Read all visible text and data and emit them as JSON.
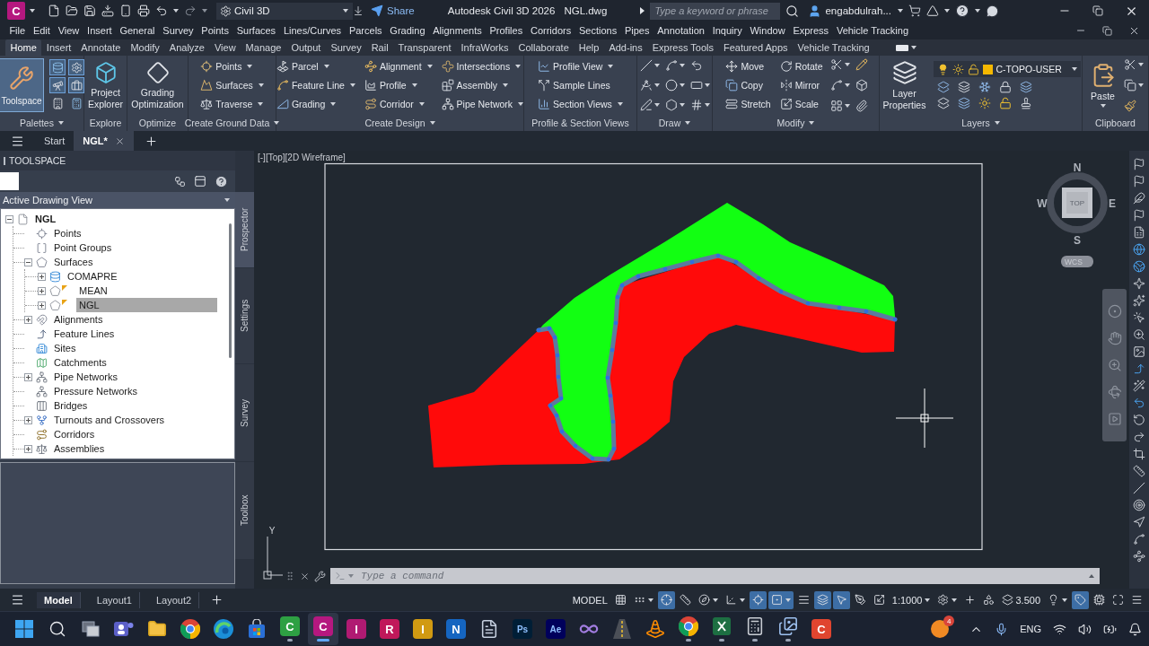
{
  "title_bar": {
    "app_letter": "C",
    "workspace": "Civil 3D",
    "share": "Share",
    "title": "Autodesk Civil 3D 2026",
    "file": "NGL.dwg",
    "search": {
      "placeholder": "Type a keyword or phrase"
    },
    "user": "engabdulrah..."
  },
  "menu_bar": [
    "File",
    "Edit",
    "View",
    "Insert",
    "General",
    "Survey",
    "Points",
    "Surfaces",
    "Lines/Curves",
    "Parcels",
    "Grading",
    "Alignments",
    "Profiles",
    "Corridors",
    "Sections",
    "Pipes",
    "Annotation",
    "Inquiry",
    "Window",
    "Express",
    "Vehicle Tracking"
  ],
  "ribbon_tabs": [
    {
      "label": "Home",
      "selected": true
    },
    {
      "label": "Insert",
      "selected": false
    },
    {
      "label": "Annotate",
      "selected": false
    },
    {
      "label": "Modify",
      "selected": false
    },
    {
      "label": "Analyze",
      "selected": false
    },
    {
      "label": "View",
      "selected": false
    },
    {
      "label": "Manage",
      "selected": false
    },
    {
      "label": "Output",
      "selected": false
    },
    {
      "label": "Survey",
      "selected": false
    },
    {
      "label": "Rail",
      "selected": false
    },
    {
      "label": "Transparent",
      "selected": false
    },
    {
      "label": "InfraWorks",
      "selected": false
    },
    {
      "label": "Collaborate",
      "selected": false
    },
    {
      "label": "Help",
      "selected": false
    },
    {
      "label": "Add-ins",
      "selected": false
    },
    {
      "label": "Express Tools",
      "selected": false
    },
    {
      "label": "Featured Apps",
      "selected": false
    },
    {
      "label": "Vehicle Tracking",
      "selected": false
    }
  ],
  "ribbon_panels": [
    {
      "kind": "palettes",
      "title": "Palettes",
      "menu": true,
      "buttons": [
        {
          "label": "Toolspace",
          "selected": true
        }
      ],
      "toggles": [
        {
          "on": true
        },
        {
          "on": true
        },
        {
          "on": true
        },
        {
          "on": true
        },
        {
          "on": false
        },
        {
          "on": false
        }
      ]
    },
    {
      "kind": "large",
      "title": "Explore",
      "buttons": [
        {
          "label": "Project Explorer"
        }
      ]
    },
    {
      "kind": "large",
      "title": "Optimize",
      "buttons": [
        {
          "label": "Grading Optimization"
        }
      ]
    },
    {
      "kind": "columns",
      "title": "Create Ground Data",
      "menu": true,
      "columns": [
        [
          {
            "label": "Points",
            "menu": true
          },
          {
            "label": "Surfaces",
            "menu": true
          },
          {
            "label": "Traverse",
            "menu": true
          }
        ]
      ]
    },
    {
      "kind": "columns",
      "title": "Create Design",
      "menu": true,
      "columns": [
        [
          {
            "label": "Parcel",
            "menu": true
          },
          {
            "label": "Feature Line",
            "menu": true
          },
          {
            "label": "Grading",
            "menu": true
          }
        ],
        [
          {
            "label": "Alignment",
            "menu": true
          },
          {
            "label": "Profile",
            "menu": true
          },
          {
            "label": "Corridor",
            "menu": true
          }
        ],
        [
          {
            "label": "Intersections",
            "menu": true
          },
          {
            "label": "Assembly",
            "menu": true
          },
          {
            "label": "Pipe Network",
            "menu": true
          }
        ]
      ]
    },
    {
      "kind": "columns",
      "title": "Profile & Section Views",
      "columns": [
        [
          {
            "label": "Profile View",
            "menu": true
          },
          {
            "label": "Sample Lines"
          },
          {
            "label": "Section Views",
            "menu": true
          }
        ]
      ]
    },
    {
      "kind": "draw",
      "title": "Draw",
      "menu": true
    },
    {
      "kind": "modify",
      "title": "Modify",
      "menu": true,
      "columns": [
        [
          {
            "label": "Move"
          },
          {
            "label": "Copy"
          },
          {
            "label": "Stretch"
          }
        ],
        [
          {
            "label": "Rotate"
          },
          {
            "label": "Mirror"
          },
          {
            "label": "Scale"
          }
        ]
      ]
    },
    {
      "kind": "layers",
      "title": "Layers",
      "menu": true,
      "buttons": [
        {
          "label": "Layer Properties"
        }
      ],
      "current_layer": "C-TOPO-USER"
    },
    {
      "kind": "clipboard",
      "title": "Clipboard",
      "buttons": [
        {
          "label": "Paste",
          "menu": true
        }
      ]
    }
  ],
  "file_tabs": [
    {
      "label": "Start",
      "selected": false
    },
    {
      "label": "NGL*",
      "selected": true
    }
  ],
  "toolspace": {
    "title": "TOOLSPACE",
    "view": "Active Drawing View",
    "tree": [
      {
        "label": "NGL",
        "kind": "drawing",
        "expanded": true,
        "selected": false,
        "children": [
          {
            "label": "Points",
            "kind": "points",
            "selected": false
          },
          {
            "label": "Point Groups",
            "kind": "point_groups",
            "selected": false
          },
          {
            "label": "Surfaces",
            "kind": "surfaces",
            "expanded": true,
            "selected": false,
            "children": [
              {
                "label": "COMAPRE",
                "kind": "volume_surface",
                "expanded": false,
                "flagged": false,
                "selected": false
              },
              {
                "label": "MEAN",
                "kind": "tin_surface",
                "expanded": false,
                "flagged": true,
                "selected": false
              },
              {
                "label": "NGL",
                "kind": "tin_surface",
                "expanded": false,
                "flagged": true,
                "selected": true
              }
            ]
          },
          {
            "label": "Alignments",
            "kind": "alignments",
            "expanded": false,
            "selected": false
          },
          {
            "label": "Feature Lines",
            "kind": "feature_lines",
            "selected": false
          },
          {
            "label": "Sites",
            "kind": "sites",
            "selected": false
          },
          {
            "label": "Catchments",
            "kind": "catchments",
            "selected": false
          },
          {
            "label": "Pipe Networks",
            "kind": "pipe_networks",
            "expanded": false,
            "selected": false
          },
          {
            "label": "Pressure Networks",
            "kind": "pressure_networks",
            "selected": false
          },
          {
            "label": "Bridges",
            "kind": "bridges",
            "selected": false
          },
          {
            "label": "Turnouts and Crossovers",
            "kind": "turnouts",
            "expanded": false,
            "selected": false
          },
          {
            "label": "Corridors",
            "kind": "corridors",
            "selected": false
          },
          {
            "label": "Assemblies",
            "kind": "assemblies",
            "expanded": false,
            "selected": false
          }
        ]
      }
    ],
    "side_tabs": [
      {
        "label": "Prospector",
        "selected": true
      },
      {
        "label": "Settings",
        "selected": false
      },
      {
        "label": "Survey",
        "selected": false
      },
      {
        "label": "Toolbox",
        "selected": false
      }
    ]
  },
  "viewport": {
    "label": "[-][Top][2D Wireframe]",
    "compass": {
      "north": "N",
      "east": "E",
      "south": "S",
      "west": "W",
      "face": "TOP"
    },
    "ucs_menu": "WCS",
    "axis_label": "Y"
  },
  "command_line": {
    "placeholder": "Type a command"
  },
  "layout_tabs": [
    {
      "label": "Model",
      "selected": true
    },
    {
      "label": "Layout1",
      "selected": false
    },
    {
      "label": "Layout2",
      "selected": false
    }
  ],
  "status_bar": [
    {
      "kind": "text",
      "label": "MODEL",
      "on": false,
      "menu": false
    },
    {
      "kind": "grid",
      "on": false,
      "menu": false
    },
    {
      "kind": "snap",
      "on": false,
      "menu": true
    },
    {
      "kind": "infer",
      "on": true,
      "menu": false
    },
    {
      "kind": "ortho",
      "on": false,
      "menu": false
    },
    {
      "kind": "polar",
      "on": false,
      "menu": true
    },
    {
      "kind": "isodraft",
      "on": false,
      "menu": true
    },
    {
      "kind": "tracking",
      "on": true,
      "menu": false
    },
    {
      "kind": "osnap",
      "on": true,
      "menu": true
    },
    {
      "kind": "lineweight",
      "on": false,
      "menu": false
    },
    {
      "kind": "transparency",
      "on": true,
      "menu": false
    },
    {
      "kind": "cycling",
      "on": true,
      "menu": false
    },
    {
      "kind": "annotation",
      "on": false,
      "menu": false
    },
    {
      "kind": "autoscale",
      "on": false,
      "menu": false
    },
    {
      "kind": "text",
      "label": "1:1000",
      "on": false,
      "menu": true
    },
    {
      "kind": "workspace",
      "on": false,
      "menu": true
    },
    {
      "kind": "plus",
      "on": false,
      "menu": false
    },
    {
      "kind": "units",
      "on": false,
      "menu": false
    },
    {
      "kind": "elevation",
      "label": "3.500",
      "on": false,
      "menu": false
    },
    {
      "kind": "isolate",
      "on": false,
      "menu": true
    },
    {
      "kind": "tag",
      "on": true,
      "menu": false
    },
    {
      "kind": "hardware",
      "on": false,
      "menu": false
    },
    {
      "kind": "fullscreen",
      "on": false,
      "menu": false
    },
    {
      "kind": "customize",
      "on": false,
      "menu": false
    }
  ],
  "taskbar": {
    "apps": [
      {
        "kind": "start",
        "selected": false,
        "running": false
      },
      {
        "kind": "search",
        "selected": false,
        "running": false
      },
      {
        "kind": "taskview",
        "selected": false,
        "running": false
      },
      {
        "kind": "teams",
        "selected": false,
        "running": false
      },
      {
        "kind": "explorer",
        "selected": false,
        "running": false
      },
      {
        "kind": "chrome",
        "selected": false,
        "running": false
      },
      {
        "kind": "edge",
        "selected": false,
        "running": false
      },
      {
        "kind": "store",
        "selected": false,
        "running": false
      },
      {
        "kind": "tile",
        "letter": "C",
        "color": "#2ea043",
        "selected": false,
        "running": true
      },
      {
        "kind": "tile",
        "letter": "C",
        "color": "#b5187f",
        "selected": true,
        "running": true
      },
      {
        "kind": "tile",
        "letter": "I",
        "color": "#b01a72",
        "selected": false,
        "running": false
      },
      {
        "kind": "tile",
        "letter": "R",
        "color": "#c0185a",
        "selected": false,
        "running": false
      },
      {
        "kind": "tile",
        "letter": "I",
        "color": "#d19a12",
        "selected": false,
        "running": false
      },
      {
        "kind": "tile",
        "letter": "N",
        "color": "#1565c0",
        "selected": false,
        "running": false
      },
      {
        "kind": "document",
        "selected": false,
        "running": false
      },
      {
        "kind": "tile",
        "letter": "Ps",
        "color": "#001e36",
        "selected": false,
        "running": false
      },
      {
        "kind": "tile",
        "letter": "Ae",
        "color": "#00005b",
        "selected": false,
        "running": false
      },
      {
        "kind": "vs",
        "selected": false,
        "running": false
      },
      {
        "kind": "road",
        "selected": false,
        "running": false
      },
      {
        "kind": "cone",
        "selected": false,
        "running": false
      },
      {
        "kind": "chrome",
        "selected": false,
        "running": true
      },
      {
        "kind": "excel",
        "selected": false,
        "running": true
      },
      {
        "kind": "calculator",
        "selected": false,
        "running": true
      },
      {
        "kind": "viewer",
        "selected": false,
        "running": true
      },
      {
        "kind": "tile",
        "letter": "C",
        "color": "#e0452f",
        "selected": false,
        "running": false
      }
    ],
    "notification_count": "4",
    "language": "ENG"
  }
}
